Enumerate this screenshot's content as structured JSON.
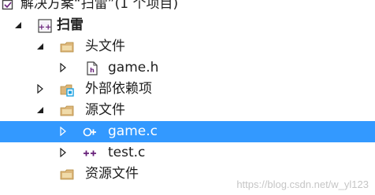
{
  "tree": {
    "solution": {
      "label": "解决方案“扫雷”(1 个项目)",
      "icon": "solution-icon"
    },
    "project": {
      "label": "扫雷",
      "icon": "cpp-project-icon",
      "expanded": true
    },
    "header_files": {
      "label": "头文件",
      "icon": "filter-folder-icon",
      "expanded": true
    },
    "game_h": {
      "label": "game.h",
      "icon": "header-file-icon",
      "expanded": false
    },
    "external_deps": {
      "label": "外部依赖项",
      "icon": "external-dependencies-icon",
      "expanded": false
    },
    "source_files": {
      "label": "源文件",
      "icon": "filter-folder-icon",
      "expanded": true
    },
    "game_c": {
      "label": "game.c",
      "icon": "cpp-source-file-icon",
      "expanded": false,
      "selected": true
    },
    "test_c": {
      "label": "test.c",
      "icon": "cpp-source-file-icon",
      "expanded": false
    },
    "resource_files": {
      "label": "资源文件",
      "icon": "filter-folder-icon"
    }
  },
  "watermark": "https://blog.csdn.net/w_yl123",
  "colors": {
    "selection": "#3399ff",
    "folder": "#dcb67a",
    "cpp_icon": "#68217a",
    "text": "#1e1e1e"
  }
}
